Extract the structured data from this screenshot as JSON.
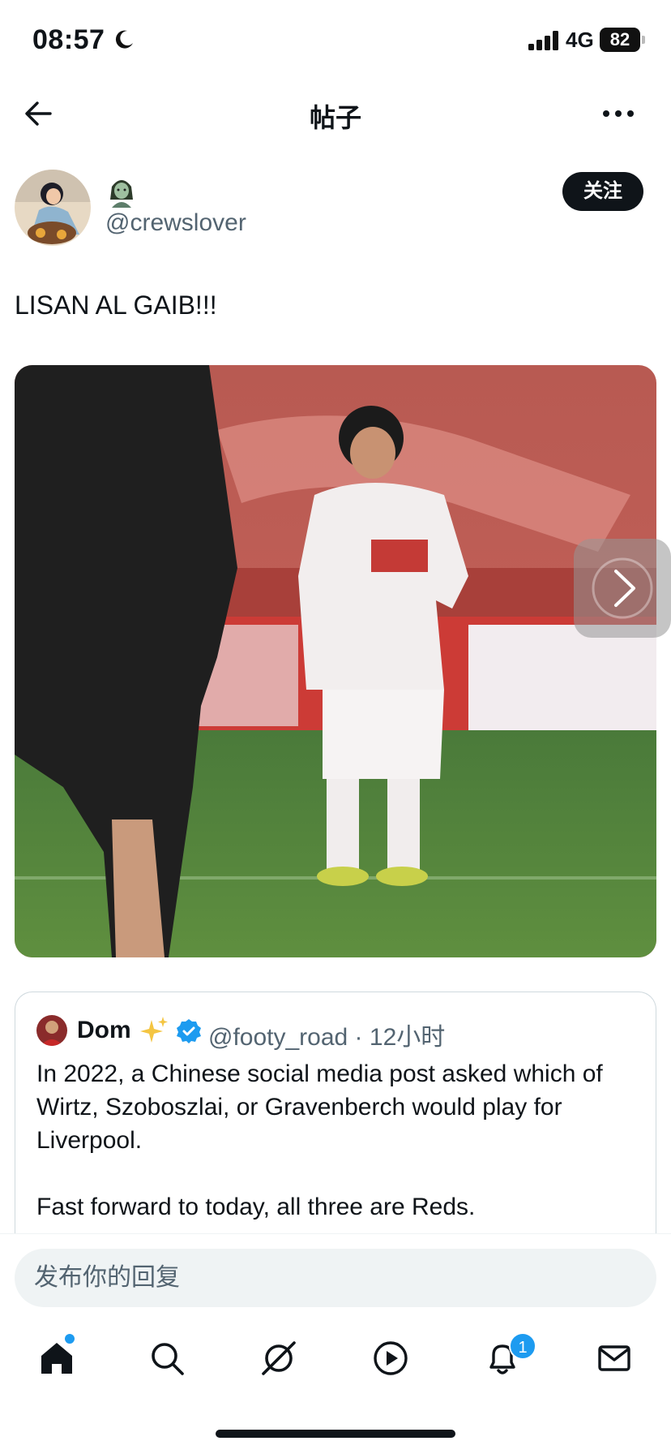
{
  "status_bar": {
    "time": "08:57",
    "network": "4G",
    "battery": "82"
  },
  "header": {
    "title": "帖子"
  },
  "post": {
    "handle": "@crewslover",
    "follow_label": "关注",
    "text": "LISAN AL GAIB!!!",
    "media_icons": {
      "next": "chevron-right-icon"
    }
  },
  "quote": {
    "name": "Dom",
    "handle_time": "@footy_road · 12小时",
    "body": "In 2022, a Chinese social media post asked which of Wirtz, Szoboszlai, or Gravenberch would play for Liverpool.\n\nFast forward to today, all three are Reds."
  },
  "reply": {
    "placeholder": "发布你的回复"
  },
  "tab_bar": {
    "notification_count": "1",
    "icons": [
      "home-icon",
      "search-icon",
      "grok-icon",
      "play-icon",
      "bell-icon",
      "mail-icon"
    ]
  },
  "colors": {
    "accent": "#1d9bf0",
    "text": "#0f1419",
    "muted": "#536471"
  }
}
